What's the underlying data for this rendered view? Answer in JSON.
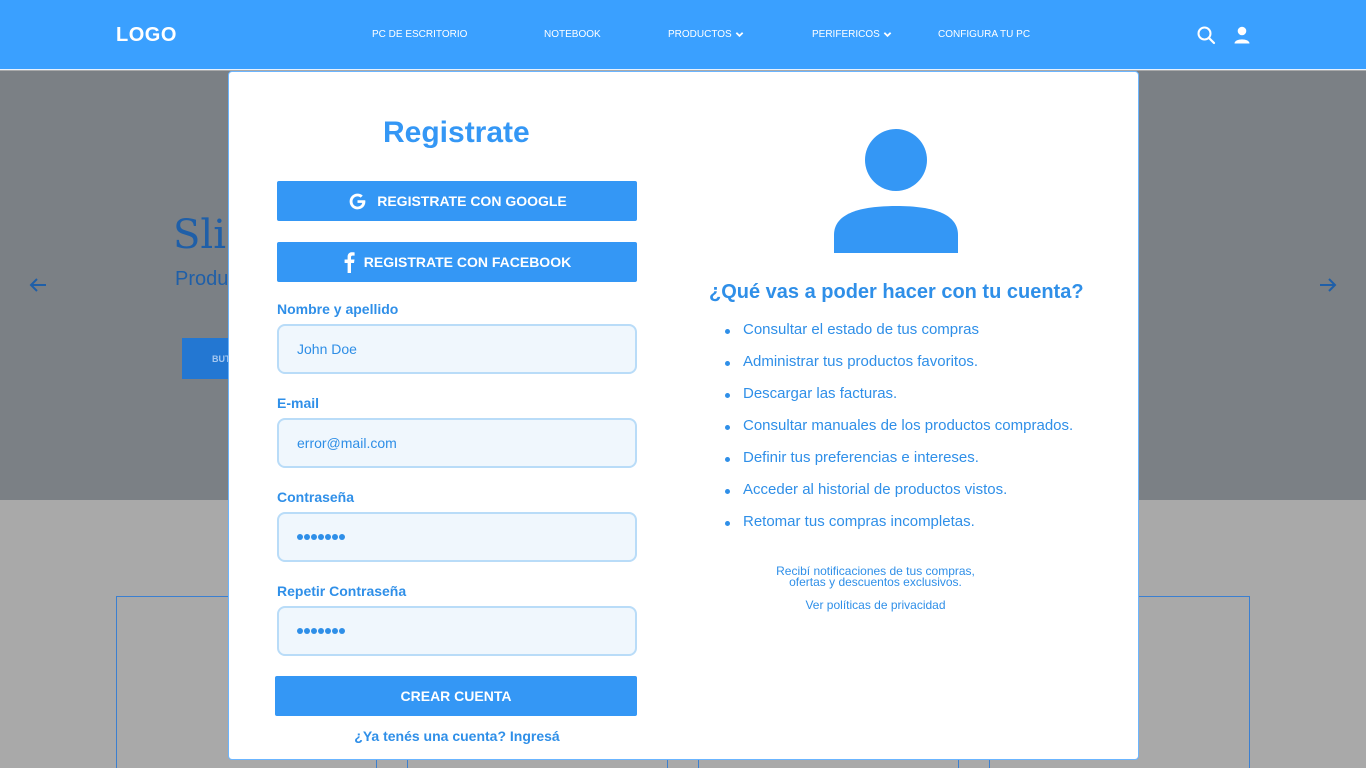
{
  "header": {
    "logo": "LOGO",
    "nav": [
      {
        "label": "PC DE ESCRITORIO"
      },
      {
        "label": "NOTEBOOK"
      },
      {
        "label": "PRODUCTOS"
      },
      {
        "label": "PERIFERICOS"
      },
      {
        "label": "CONFIGURA TU PC"
      }
    ],
    "icons": [
      "search-icon",
      "user-icon"
    ]
  },
  "background": {
    "hero_title": "Slic",
    "hero_subtitle": "Produ",
    "hero_button": "BUT",
    "arrows": [
      "arrow-left-icon",
      "arrow-right-icon"
    ]
  },
  "modal": {
    "title": "Registrate",
    "google_button": "REGISTRATE CON GOOGLE",
    "facebook_button": "REGISTRATE CON FACEBOOK",
    "fields": {
      "name_label": "Nombre y apellido",
      "name_value": "John Doe",
      "email_label": "E-mail",
      "email_value": "error@mail.com",
      "password_label": "Contraseña",
      "password_length": 7,
      "repeat_password_label": "Repetir Contraseña",
      "repeat_password_length": 7
    },
    "create_button": "CREAR CUENTA",
    "login_link": "¿Ya tenés una cuenta? Ingresá",
    "benefits_title": "¿Qué vas a poder hacer con tu cuenta?",
    "benefits": [
      "Consultar el estado de tus compras",
      "Administrar tus productos favoritos.",
      "Descargar las facturas.",
      "Consultar manuales de los productos comprados.",
      "Definir tus preferencias e intereses.",
      "Acceder al historial de productos vistos.",
      "Retomar tus compras incompletas."
    ],
    "note_line1": "Recibí notificaciones de tus compras,",
    "note_line2": "ofertas y descuentos exclusivos.",
    "privacy_link": "Ver políticas de privacidad"
  },
  "colors": {
    "primary": "#3497f5",
    "header": "#3aa0ff",
    "text_blue": "#2f8fe8",
    "input_bg": "#f0f7fd"
  }
}
